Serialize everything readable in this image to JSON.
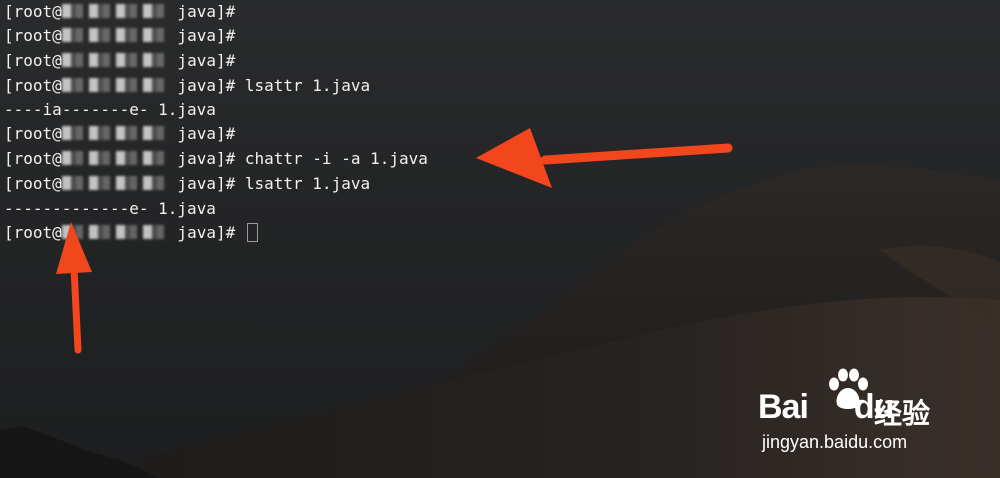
{
  "terminal": {
    "lines": [
      {
        "prefix": "[root@",
        "suffix": " java]#",
        "command": ""
      },
      {
        "prefix": "[root@",
        "suffix": " java]#",
        "command": ""
      },
      {
        "prefix": "[root@",
        "suffix": " java]#",
        "command": ""
      },
      {
        "prefix": "[root@",
        "suffix": " java]#",
        "command": " lsattr 1.java"
      },
      {
        "output": "----ia-------e- 1.java"
      },
      {
        "prefix": "[root@",
        "suffix": " java]#",
        "command": ""
      },
      {
        "prefix": "[root@",
        "suffix": " java]#",
        "command": " chattr -i -a 1.java"
      },
      {
        "prefix": "[root@",
        "suffix": " java]#",
        "command": " lsattr 1.java"
      },
      {
        "output": "-------------e- 1.java"
      },
      {
        "prefix": "[root@",
        "suffix": " java]#",
        "command": " "
      }
    ]
  },
  "annotations": {
    "arrow_color": "#f2461d",
    "arrows": [
      "pointing-left-to-chattr-command",
      "pointing-up-to-attribute-output"
    ]
  },
  "watermark": {
    "brand": "Bai",
    "brand_du": "du",
    "brand_product": "经验",
    "url": "jingyan.baidu.com",
    "icon": "baidu-paw-icon"
  }
}
